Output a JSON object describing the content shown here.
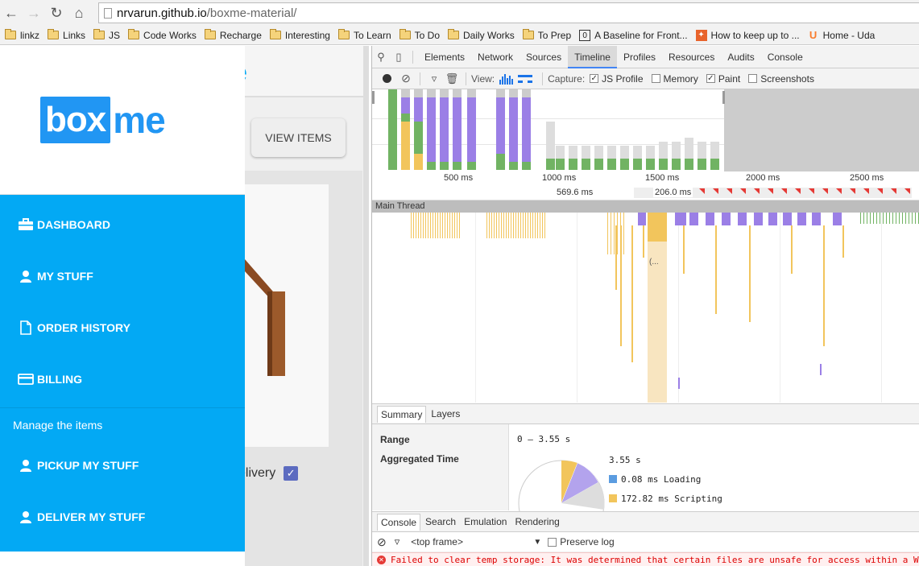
{
  "browser": {
    "url_host": "nrvarun.github.io",
    "url_path": "/boxme-material/",
    "bookmarks": [
      {
        "label": "linkz",
        "icon": "folder-icon"
      },
      {
        "label": "Links",
        "icon": "folder-icon"
      },
      {
        "label": "JS",
        "icon": "folder-icon"
      },
      {
        "label": "Code Works",
        "icon": "folder-icon"
      },
      {
        "label": "Recharge",
        "icon": "folder-icon"
      },
      {
        "label": "Interesting",
        "icon": "folder-icon"
      },
      {
        "label": "To Learn",
        "icon": "folder-icon"
      },
      {
        "label": "To Do",
        "icon": "folder-icon"
      },
      {
        "label": "Daily Works",
        "icon": "folder-icon"
      },
      {
        "label": "To Prep",
        "icon": "folder-icon"
      },
      {
        "label": "A Baseline for Front...",
        "icon": "page-icon"
      },
      {
        "label": "How to keep up to ...",
        "icon": "puzzle-icon"
      },
      {
        "label": "Home - Uda",
        "icon": "udacity-icon"
      }
    ]
  },
  "site": {
    "view_items_label": "VIEW ITEMS",
    "delivery_label": "elivery",
    "logo_box": "box",
    "logo_me": "me",
    "nav": {
      "dashboard": "DASHBOARD",
      "my_stuff": "MY STUFF",
      "order_history": "ORDER HISTORY",
      "billing": "BILLING",
      "subheader": "Manage the items",
      "pickup": "PICKUP MY STUFF",
      "deliver": "DELIVER MY STUFF"
    },
    "colors": {
      "primary": "#03A9F4",
      "logo": "#2196F3"
    }
  },
  "devtools": {
    "tabs": [
      "Elements",
      "Network",
      "Sources",
      "Timeline",
      "Profiles",
      "Resources",
      "Audits",
      "Console"
    ],
    "active_tab": "Timeline",
    "toolbar": {
      "view_label": "View:",
      "capture_label": "Capture:",
      "js_profile": "JS Profile",
      "memory": "Memory",
      "paint": "Paint",
      "screenshots": "Screenshots"
    },
    "ruler": {
      "ticks": [
        "500 ms",
        "1000 ms",
        "1500 ms",
        "2000 ms",
        "2500 ms"
      ],
      "frame_a": "569.6 ms",
      "frame_b": "206.0 ms"
    },
    "main_thread_label": "Main Thread",
    "flame_label": "(...",
    "summary_tabs": [
      "Summary",
      "Layers"
    ],
    "summary": {
      "range_label": "Range",
      "range_value": "0 – 3.55 s",
      "agg_label": "Aggregated Time",
      "total": "3.55 s",
      "loading": "0.08 ms Loading",
      "scripting": "172.82 ms Scripting"
    },
    "console_tabs": [
      "Console",
      "Search",
      "Emulation",
      "Rendering"
    ],
    "console": {
      "frame": "<top frame>",
      "preserve_log": "Preserve log",
      "error": "Failed to clear temp storage: It was determined that certain files are unsafe for access within a We"
    },
    "colors": {
      "scripting": "#f2c55c",
      "rendering": "#9b7fe6",
      "painting": "#71b363",
      "idle": "#ccc",
      "loading": "#5b9ce0"
    }
  }
}
